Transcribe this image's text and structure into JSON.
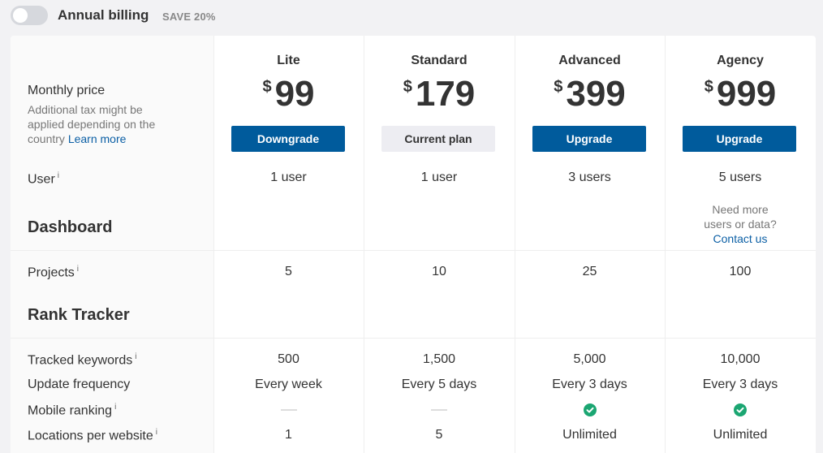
{
  "topbar": {
    "toggle_on": false,
    "billing_label": "Annual billing",
    "save_badge": "SAVE 20%"
  },
  "left": {
    "monthly_price_label": "Monthly price",
    "tax_note": "Additional tax might be applied depending on the country",
    "learn_more": "Learn more",
    "user_label": "User",
    "info_glyph": "i",
    "dashboard_section": "Dashboard",
    "projects_label": "Projects",
    "rank_tracker_section": "Rank Tracker",
    "tracked_keywords_label": "Tracked keywords",
    "update_frequency_label": "Update frequency",
    "mobile_ranking_label": "Mobile ranking",
    "locations_label": "Locations per website"
  },
  "colors": {
    "primary_button": "#005b9c",
    "current_button": "#ededf2",
    "check_green": "#1ba672",
    "link": "#0b5fa5"
  },
  "currency": "$",
  "need_more": "Need more users or data?",
  "contact_us": "Contact us",
  "plans": [
    {
      "name": "Lite",
      "price": "99",
      "button": "Downgrade",
      "button_type": "primary",
      "users": "1 user",
      "projects": "5",
      "tracked_keywords": "500",
      "update_frequency": "Every week",
      "mobile_ranking": "dash",
      "locations": "1"
    },
    {
      "name": "Standard",
      "price": "179",
      "button": "Current plan",
      "button_type": "current",
      "users": "1 user",
      "projects": "10",
      "tracked_keywords": "1,500",
      "update_frequency": "Every 5 days",
      "mobile_ranking": "dash",
      "locations": "5"
    },
    {
      "name": "Advanced",
      "price": "399",
      "button": "Upgrade",
      "button_type": "primary",
      "users": "3 users",
      "projects": "25",
      "tracked_keywords": "5,000",
      "update_frequency": "Every 3 days",
      "mobile_ranking": "check",
      "locations": "Unlimited"
    },
    {
      "name": "Agency",
      "price": "999",
      "button": "Upgrade",
      "button_type": "primary",
      "users": "5 users",
      "projects": "100",
      "tracked_keywords": "10,000",
      "update_frequency": "Every 3 days",
      "mobile_ranking": "check",
      "locations": "Unlimited"
    }
  ]
}
